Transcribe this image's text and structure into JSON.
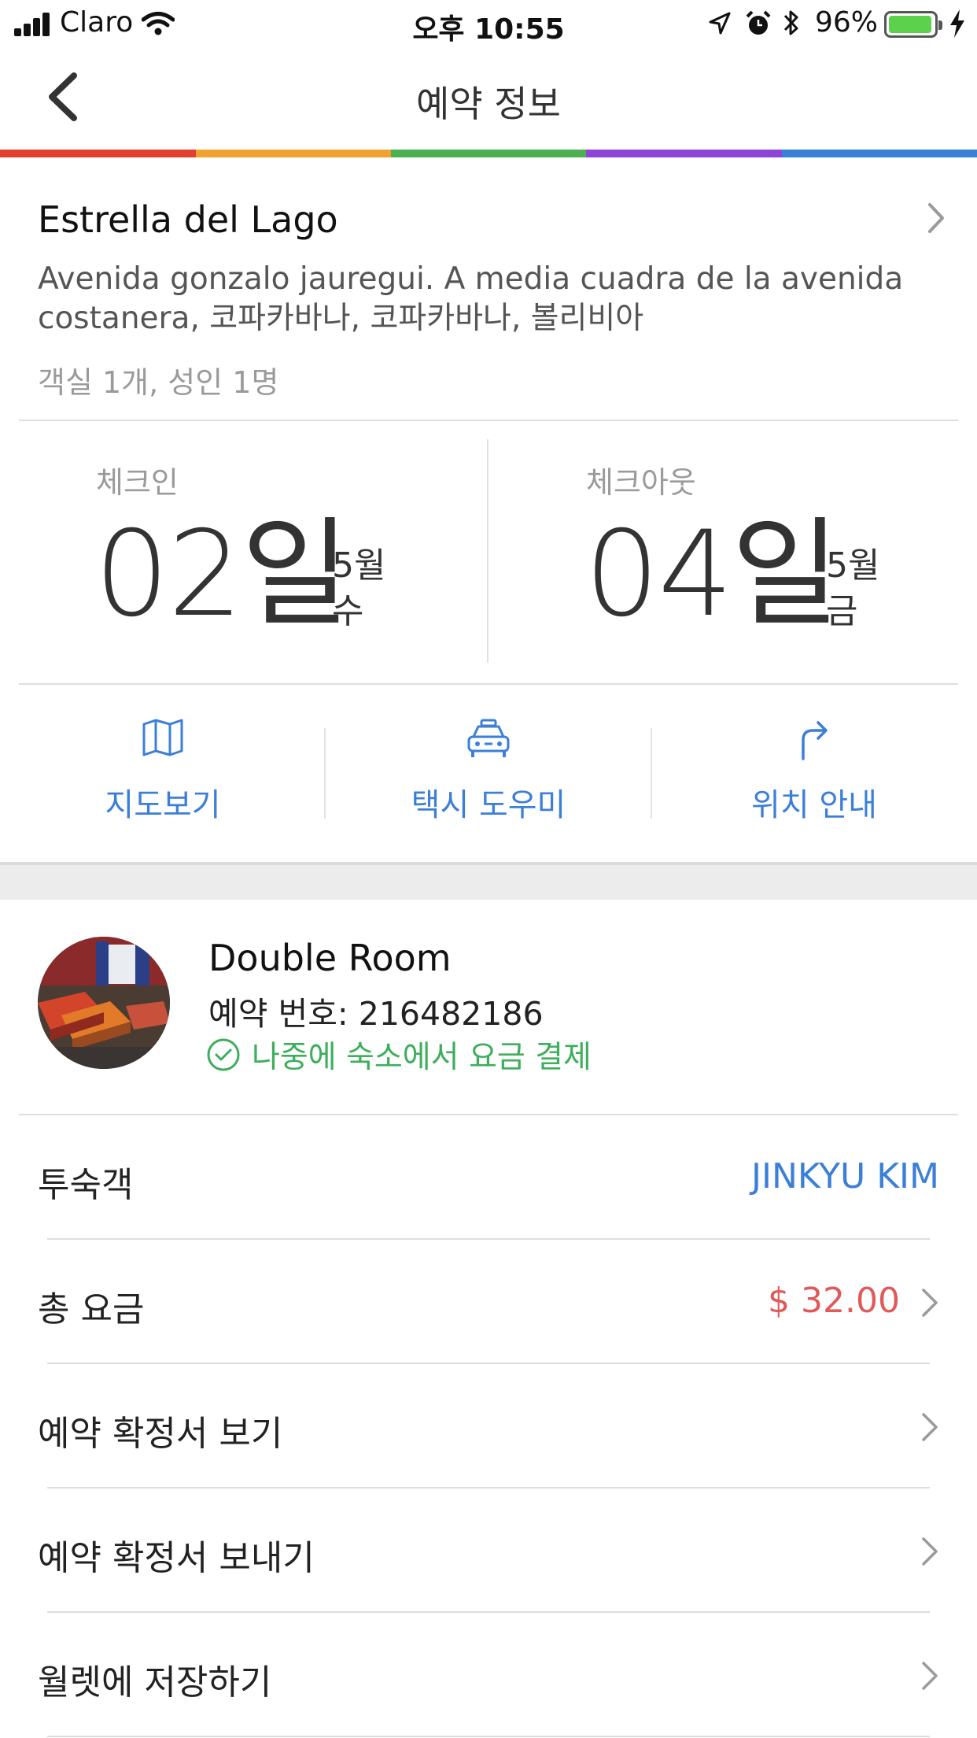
{
  "status_bar": {
    "carrier": "Claro",
    "time": "오후 10:55",
    "battery_percent": "96%",
    "battery_level": 0.96,
    "icons": [
      "signal-icon",
      "wifi-icon",
      "location-arrow-icon",
      "alarm-icon",
      "bluetooth-icon",
      "battery-icon",
      "charging-bolt-icon"
    ]
  },
  "nav": {
    "title": "예약 정보",
    "back_icon": "back-chevron-icon"
  },
  "colors": {
    "rainbow": [
      "#e43e2f",
      "#f0a130",
      "#4caf50",
      "#8e44d6",
      "#3a80d9"
    ],
    "accent_blue": "#3b7fd8",
    "price_red": "#e05a5a",
    "pay_green": "#3dae5b"
  },
  "hotel": {
    "name": "Estrella del Lago",
    "address": "Avenida gonzalo  jauregui. A media cuadra de la avenida costanera, 코파카바나, 코파카바나, 볼리비아",
    "guests": "객실 1개, 성인 1명"
  },
  "checkin": {
    "label": "체크인",
    "day": "02일",
    "month": "5월",
    "weekday": "수"
  },
  "checkout": {
    "label": "체크아웃",
    "day": "04일",
    "month": "5월",
    "weekday": "금"
  },
  "actions": [
    {
      "label": "지도보기",
      "icon": "map-icon"
    },
    {
      "label": "택시 도우미",
      "icon": "taxi-icon"
    },
    {
      "label": "위치 안내",
      "icon": "directions-arrow-icon"
    }
  ],
  "room": {
    "name": "Double Room",
    "booking_number": "예약 번호: 216482186",
    "payment_note": "나중에 숙소에서 요금 결제"
  },
  "rows": [
    {
      "label": "투숙객",
      "value": "JINKYU KIM"
    },
    {
      "label": "총 요금",
      "value": "$ 32.00"
    },
    {
      "label": "예약 확정서 보기"
    },
    {
      "label": "예약 확정서 보내기"
    },
    {
      "label": "월렛에 저장하기"
    }
  ]
}
